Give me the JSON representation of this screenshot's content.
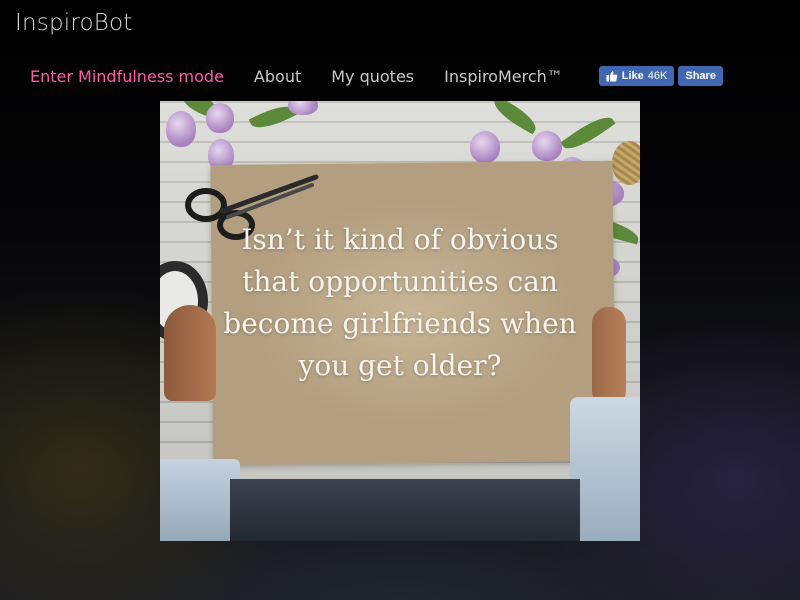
{
  "app": {
    "title": "InspiroBot"
  },
  "nav": {
    "mindfulness_label": "Enter Mindfulness mode",
    "about_label": "About",
    "my_quotes_label": "My quotes",
    "merch_label": "InspiroMerch™"
  },
  "facebook": {
    "like_label": "Like",
    "like_count": "46K",
    "share_label": "Share",
    "button_color": "#4267b2"
  },
  "quote": {
    "text": "Isn’t it kind of obvious that opportunities can become girlfriends when you get older?"
  },
  "colors": {
    "accent": "#ff5ca8",
    "nav_text": "#c8c8c8",
    "title_text": "#d7d7d7"
  }
}
